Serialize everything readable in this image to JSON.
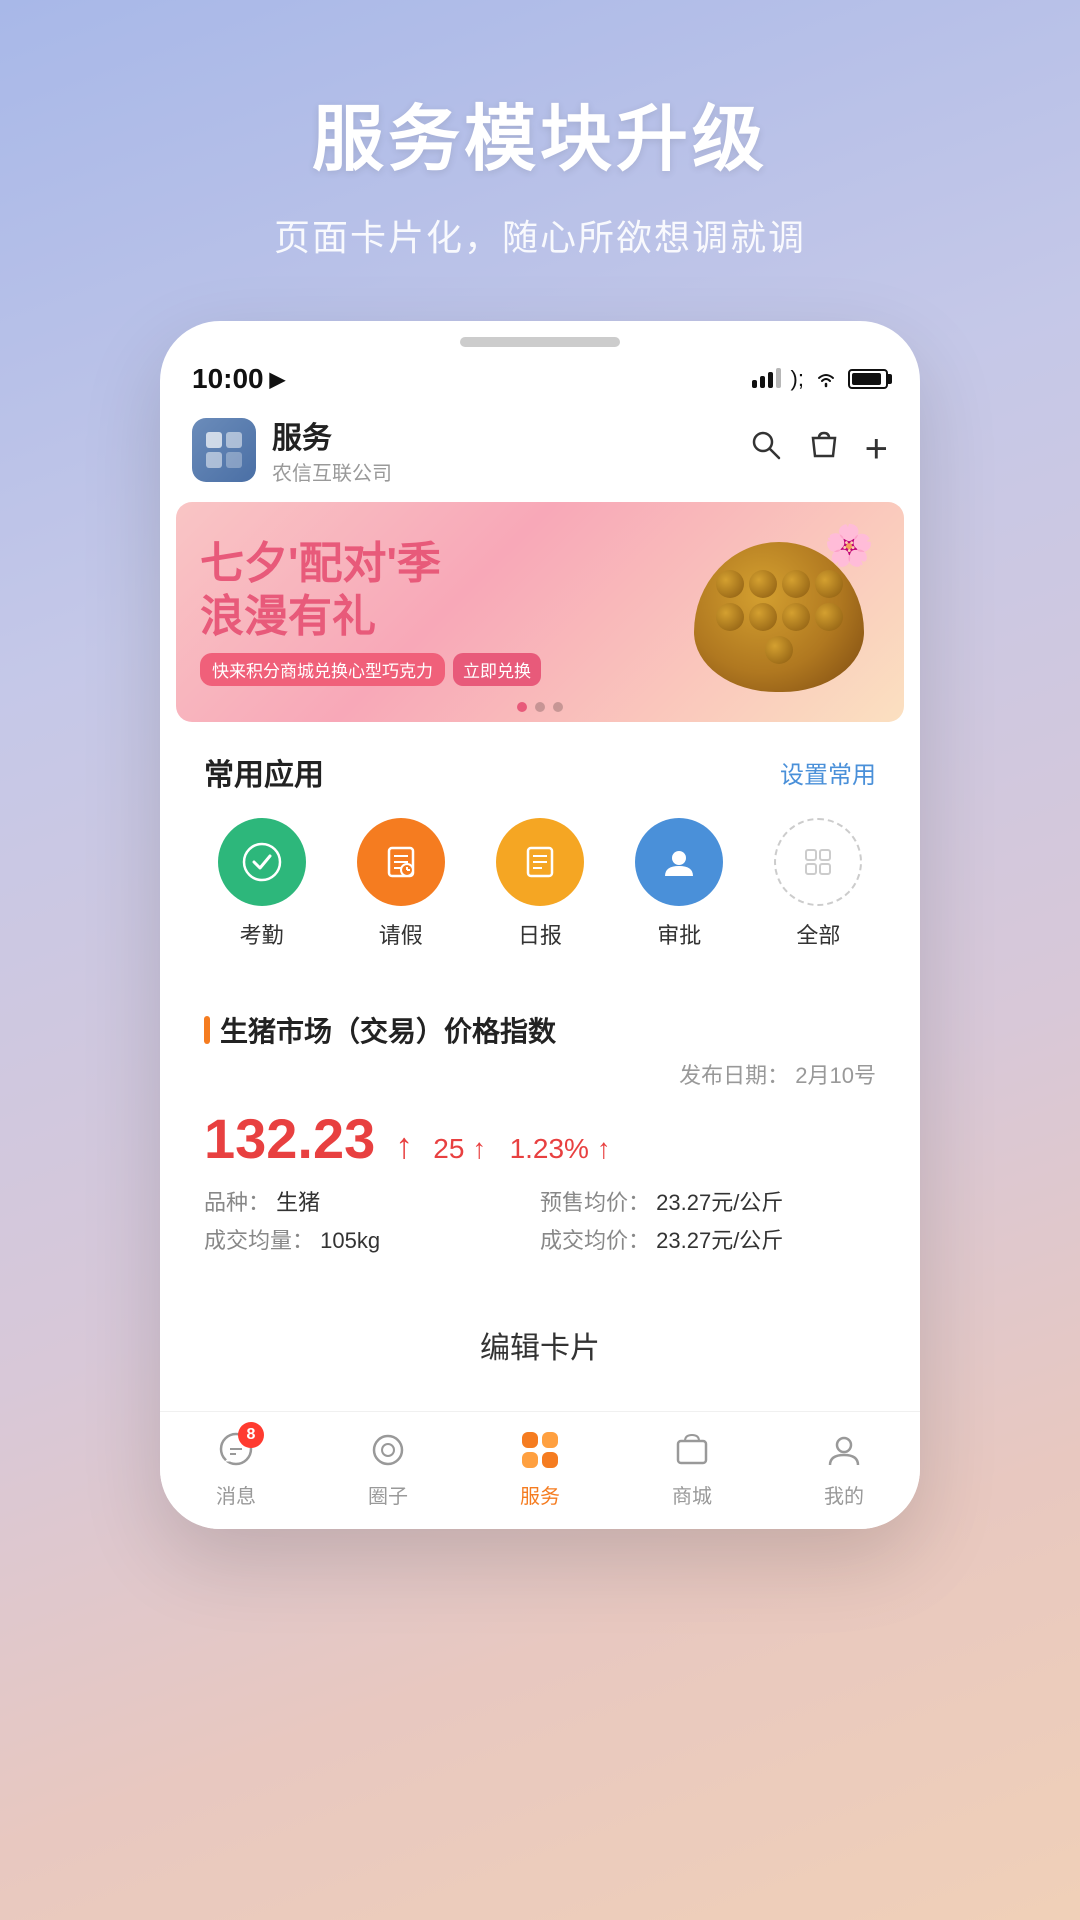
{
  "page": {
    "background": "linear-gradient(160deg, #a8b8e8, #c5c8e8, #d8c8d8, #e8c8c0, #f0d0b8)"
  },
  "header": {
    "title": "服务模块升级",
    "subtitle": "页面卡片化，随心所欲想调就调"
  },
  "status_bar": {
    "time": "10:00",
    "location_arrow": "▶"
  },
  "app_header": {
    "app_name": "服务",
    "app_sub": "农信互联公司"
  },
  "banner": {
    "line1": "七夕'配对'季",
    "line2": "浪漫有礼",
    "hearts": "♥ ♥",
    "sub_text": "快来积分商城兑换心型巧克力",
    "link_text": "立即兑换",
    "dots": [
      true,
      false,
      false
    ]
  },
  "common_apps": {
    "section_title": "常用应用",
    "action_text": "设置常用",
    "apps": [
      {
        "label": "考勤",
        "icon_type": "green",
        "icon_symbol": "⊙"
      },
      {
        "label": "请假",
        "icon_type": "orange",
        "icon_symbol": "📋"
      },
      {
        "label": "日报",
        "icon_type": "amber",
        "icon_symbol": "📄"
      },
      {
        "label": "审批",
        "icon_type": "blue",
        "icon_symbol": "👤"
      },
      {
        "label": "全部",
        "icon_type": "outline",
        "icon_symbol": "⊞"
      }
    ]
  },
  "market": {
    "section_title": "生猪市场（交易）价格指数",
    "date_label": "发布日期：",
    "date_value": "2月10号",
    "price_main": "132.23",
    "price_arrow": "↑",
    "change_value": "25",
    "change_arrow": "↑",
    "change_pct": "1.23%",
    "change_pct_arrow": "↑",
    "details": [
      {
        "label": "品种：",
        "value": "生猪"
      },
      {
        "label": "预售均价：",
        "value": "23.27元/公斤"
      },
      {
        "label": "成交均量：",
        "value": "105kg"
      },
      {
        "label": "成交均价：",
        "value": "23.27元/公斤"
      }
    ]
  },
  "edit_card": {
    "label": "编辑卡片"
  },
  "bottom_nav": {
    "items": [
      {
        "label": "消息",
        "icon": "💬",
        "badge": "8",
        "active": false
      },
      {
        "label": "圈子",
        "icon": "⊙",
        "badge": null,
        "active": false
      },
      {
        "label": "服务",
        "icon": "grid",
        "badge": null,
        "active": true
      },
      {
        "label": "商城",
        "icon": "🛍",
        "badge": null,
        "active": false
      },
      {
        "label": "我的",
        "icon": "👤",
        "badge": null,
        "active": false
      }
    ]
  }
}
